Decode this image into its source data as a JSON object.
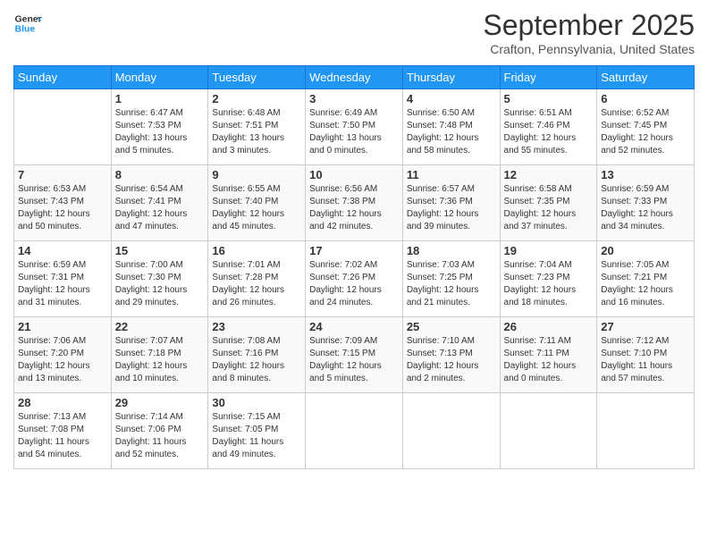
{
  "logo": {
    "text_general": "General",
    "text_blue": "Blue"
  },
  "title": "September 2025",
  "location": "Crafton, Pennsylvania, United States",
  "days_of_week": [
    "Sunday",
    "Monday",
    "Tuesday",
    "Wednesday",
    "Thursday",
    "Friday",
    "Saturday"
  ],
  "weeks": [
    [
      {
        "num": "",
        "info": ""
      },
      {
        "num": "1",
        "info": "Sunrise: 6:47 AM\nSunset: 7:53 PM\nDaylight: 13 hours\nand 5 minutes."
      },
      {
        "num": "2",
        "info": "Sunrise: 6:48 AM\nSunset: 7:51 PM\nDaylight: 13 hours\nand 3 minutes."
      },
      {
        "num": "3",
        "info": "Sunrise: 6:49 AM\nSunset: 7:50 PM\nDaylight: 13 hours\nand 0 minutes."
      },
      {
        "num": "4",
        "info": "Sunrise: 6:50 AM\nSunset: 7:48 PM\nDaylight: 12 hours\nand 58 minutes."
      },
      {
        "num": "5",
        "info": "Sunrise: 6:51 AM\nSunset: 7:46 PM\nDaylight: 12 hours\nand 55 minutes."
      },
      {
        "num": "6",
        "info": "Sunrise: 6:52 AM\nSunset: 7:45 PM\nDaylight: 12 hours\nand 52 minutes."
      }
    ],
    [
      {
        "num": "7",
        "info": "Sunrise: 6:53 AM\nSunset: 7:43 PM\nDaylight: 12 hours\nand 50 minutes."
      },
      {
        "num": "8",
        "info": "Sunrise: 6:54 AM\nSunset: 7:41 PM\nDaylight: 12 hours\nand 47 minutes."
      },
      {
        "num": "9",
        "info": "Sunrise: 6:55 AM\nSunset: 7:40 PM\nDaylight: 12 hours\nand 45 minutes."
      },
      {
        "num": "10",
        "info": "Sunrise: 6:56 AM\nSunset: 7:38 PM\nDaylight: 12 hours\nand 42 minutes."
      },
      {
        "num": "11",
        "info": "Sunrise: 6:57 AM\nSunset: 7:36 PM\nDaylight: 12 hours\nand 39 minutes."
      },
      {
        "num": "12",
        "info": "Sunrise: 6:58 AM\nSunset: 7:35 PM\nDaylight: 12 hours\nand 37 minutes."
      },
      {
        "num": "13",
        "info": "Sunrise: 6:59 AM\nSunset: 7:33 PM\nDaylight: 12 hours\nand 34 minutes."
      }
    ],
    [
      {
        "num": "14",
        "info": "Sunrise: 6:59 AM\nSunset: 7:31 PM\nDaylight: 12 hours\nand 31 minutes."
      },
      {
        "num": "15",
        "info": "Sunrise: 7:00 AM\nSunset: 7:30 PM\nDaylight: 12 hours\nand 29 minutes."
      },
      {
        "num": "16",
        "info": "Sunrise: 7:01 AM\nSunset: 7:28 PM\nDaylight: 12 hours\nand 26 minutes."
      },
      {
        "num": "17",
        "info": "Sunrise: 7:02 AM\nSunset: 7:26 PM\nDaylight: 12 hours\nand 24 minutes."
      },
      {
        "num": "18",
        "info": "Sunrise: 7:03 AM\nSunset: 7:25 PM\nDaylight: 12 hours\nand 21 minutes."
      },
      {
        "num": "19",
        "info": "Sunrise: 7:04 AM\nSunset: 7:23 PM\nDaylight: 12 hours\nand 18 minutes."
      },
      {
        "num": "20",
        "info": "Sunrise: 7:05 AM\nSunset: 7:21 PM\nDaylight: 12 hours\nand 16 minutes."
      }
    ],
    [
      {
        "num": "21",
        "info": "Sunrise: 7:06 AM\nSunset: 7:20 PM\nDaylight: 12 hours\nand 13 minutes."
      },
      {
        "num": "22",
        "info": "Sunrise: 7:07 AM\nSunset: 7:18 PM\nDaylight: 12 hours\nand 10 minutes."
      },
      {
        "num": "23",
        "info": "Sunrise: 7:08 AM\nSunset: 7:16 PM\nDaylight: 12 hours\nand 8 minutes."
      },
      {
        "num": "24",
        "info": "Sunrise: 7:09 AM\nSunset: 7:15 PM\nDaylight: 12 hours\nand 5 minutes."
      },
      {
        "num": "25",
        "info": "Sunrise: 7:10 AM\nSunset: 7:13 PM\nDaylight: 12 hours\nand 2 minutes."
      },
      {
        "num": "26",
        "info": "Sunrise: 7:11 AM\nSunset: 7:11 PM\nDaylight: 12 hours\nand 0 minutes."
      },
      {
        "num": "27",
        "info": "Sunrise: 7:12 AM\nSunset: 7:10 PM\nDaylight: 11 hours\nand 57 minutes."
      }
    ],
    [
      {
        "num": "28",
        "info": "Sunrise: 7:13 AM\nSunset: 7:08 PM\nDaylight: 11 hours\nand 54 minutes."
      },
      {
        "num": "29",
        "info": "Sunrise: 7:14 AM\nSunset: 7:06 PM\nDaylight: 11 hours\nand 52 minutes."
      },
      {
        "num": "30",
        "info": "Sunrise: 7:15 AM\nSunset: 7:05 PM\nDaylight: 11 hours\nand 49 minutes."
      },
      {
        "num": "",
        "info": ""
      },
      {
        "num": "",
        "info": ""
      },
      {
        "num": "",
        "info": ""
      },
      {
        "num": "",
        "info": ""
      }
    ]
  ]
}
